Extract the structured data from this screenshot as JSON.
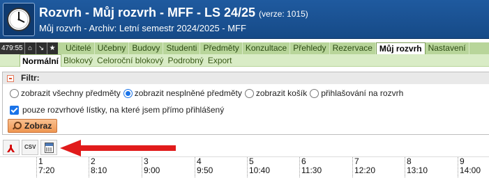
{
  "header": {
    "title": "Rozvrh - Můj rozvrh - MFF - LS 24/25",
    "version": "(verze: 1015)",
    "subtitle": "Můj rozvrh - Archiv: Letní semestr 2024/2025 - MFF",
    "logo_icon": "clock-icon"
  },
  "nav": {
    "clock": "479:55",
    "buttons": [
      "home-icon",
      "collapse-icon",
      "star-icon"
    ],
    "tabs": [
      {
        "label": "Učitelé",
        "active": false
      },
      {
        "label": "Učebny",
        "active": false
      },
      {
        "label": "Budovy",
        "active": false
      },
      {
        "label": "Studenti",
        "active": false
      },
      {
        "label": "Předměty",
        "active": false
      },
      {
        "label": "Konzultace",
        "active": false
      },
      {
        "label": "Přehledy",
        "active": false
      },
      {
        "label": "Rezervace",
        "active": false
      },
      {
        "label": "Můj rozvrh",
        "active": true
      },
      {
        "label": "Nastavení",
        "active": false
      }
    ]
  },
  "subnav": {
    "tabs": [
      {
        "label": "Normální",
        "active": true
      },
      {
        "label": "Blokový",
        "active": false
      },
      {
        "label": "Celoroční blokový",
        "active": false
      },
      {
        "label": "Podrobný",
        "active": false
      },
      {
        "label": "Export",
        "active": false
      }
    ]
  },
  "filter": {
    "title": "Filtr:",
    "radios": [
      {
        "label": "zobrazit všechny předměty",
        "checked": false
      },
      {
        "label": "zobrazit nesplněné předměty",
        "checked": true
      },
      {
        "label": "zobrazit košík",
        "checked": false
      },
      {
        "label": "přihlašování na rozvrh",
        "checked": false
      }
    ],
    "checkbox_label": "pouze rozvrhové lístky, na které jsem přímo přihlášený",
    "checkbox_checked": true,
    "search_label": "Zobraz"
  },
  "exports": {
    "pdf_icon": "pdf-icon",
    "csv_label": "CSV",
    "ics_icon": "calendar-export-icon",
    "arrow_color": "#e11b1b"
  },
  "timeline": {
    "slots": [
      {
        "num": "1",
        "time": "7:20"
      },
      {
        "num": "2",
        "time": "8:10"
      },
      {
        "num": "3",
        "time": "9:00"
      },
      {
        "num": "4",
        "time": "9:50"
      },
      {
        "num": "5",
        "time": "10:40"
      },
      {
        "num": "6",
        "time": "11:30"
      },
      {
        "num": "7",
        "time": "12:20"
      },
      {
        "num": "8",
        "time": "13:10"
      },
      {
        "num": "9",
        "time": "14:00"
      }
    ]
  },
  "colors": {
    "header_bg": "#1f5a9f",
    "nav_bg": "#b8d59a",
    "subnav_bg": "#d9ecc6",
    "button_bg": "#ef9651"
  }
}
